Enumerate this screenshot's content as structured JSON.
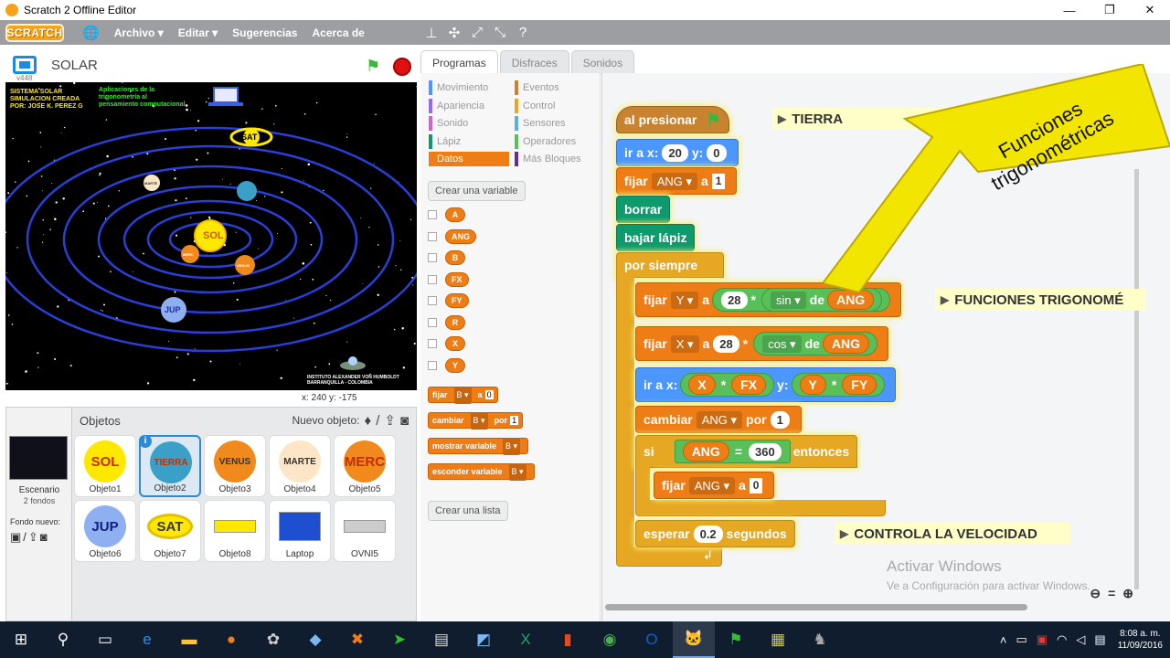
{
  "window": {
    "title": "Scratch 2 Offline Editor"
  },
  "menu": {
    "logo": "SCRATCH",
    "items": [
      "Archivo ▾",
      "Editar ▾",
      "Sugerencias",
      "Acerca de"
    ]
  },
  "stage": {
    "title": "SOLAR",
    "version": "v448",
    "coords": "x: 240  y: -175",
    "header_text": "SISTEMA SOLAR\nSIMULACION CREADA\nPOR: JOSE K. PEREZ G",
    "subtitle_text": "Aplicaciones de la\ntrigonometría al\npensamiento computacional",
    "footer_text": "INSTITUTO ALEXANDER VON HUMBOLDT\nBARRANQUILLA - COLOMBIA",
    "planet_labels": {
      "sun": "SOL",
      "sat": "SAT",
      "jup": "JUP",
      "merc": "MERC",
      "venus": "VENUS",
      "marte": "MARTE"
    }
  },
  "sprites": {
    "header": "Objetos",
    "new_label": "Nuevo objeto:",
    "stage_label": "Escenario",
    "stage_sub": "2 fondos",
    "backdrop_label": "Fondo nuevo:",
    "items": [
      {
        "name": "Objeto1",
        "label": "SOL",
        "color": "#ffe800"
      },
      {
        "name": "Objeto2",
        "label": "TIERRA",
        "color": "#3aa0c8"
      },
      {
        "name": "Objeto3",
        "label": "VENUS",
        "color": "#f08a1c"
      },
      {
        "name": "Objeto4",
        "label": "MARTE",
        "color": "#fde6c8"
      },
      {
        "name": "Objeto5",
        "label": "MERC",
        "color": "#f08a1c"
      },
      {
        "name": "Objeto6",
        "label": "JUP",
        "color": "#8fb0f0"
      },
      {
        "name": "Objeto7",
        "label": "SAT",
        "color": "#ffe800"
      },
      {
        "name": "Objeto8",
        "label": "",
        "color": "#ffe800"
      },
      {
        "name": "Laptop",
        "label": "",
        "color": "#1e4fd0"
      },
      {
        "name": "OVNI5",
        "label": "",
        "color": "#cccccc"
      }
    ]
  },
  "tabs": [
    "Programas",
    "Disfraces",
    "Sonidos"
  ],
  "categories": {
    "left": [
      {
        "label": "Movimiento",
        "color": "#4c97ff"
      },
      {
        "label": "Apariencia",
        "color": "#9966ff"
      },
      {
        "label": "Sonido",
        "color": "#cf63cf"
      },
      {
        "label": "Lápiz",
        "color": "#0e9a6c"
      },
      {
        "label": "Datos",
        "color": "#ee7d16"
      }
    ],
    "right": [
      {
        "label": "Eventos",
        "color": "#c88330"
      },
      {
        "label": "Control",
        "color": "#e6a822"
      },
      {
        "label": "Sensores",
        "color": "#5cb1d6"
      },
      {
        "label": "Operadores",
        "color": "#59c059"
      },
      {
        "label": "Más Bloques",
        "color": "#632d99"
      }
    ]
  },
  "palette": {
    "make_var": "Crear una variable",
    "make_list": "Crear una lista",
    "variables": [
      "A",
      "ANG",
      "B",
      "FX",
      "FY",
      "R",
      "X",
      "Y"
    ],
    "blocks": {
      "set": {
        "verb": "fijar",
        "var": "B ▾",
        "prep": "a",
        "val": "0"
      },
      "change": {
        "verb": "cambiar",
        "var": "B ▾",
        "prep": "por",
        "val": "1"
      },
      "show": {
        "verb": "mostrar variable",
        "var": "B ▾"
      },
      "hide": {
        "verb": "esconder variable",
        "var": "B ▾"
      }
    }
  },
  "script": {
    "hat": "al presionar",
    "goto1": {
      "verb": "ir a x:",
      "x": "20",
      "ylbl": "y:",
      "y": "0"
    },
    "set_ang": {
      "verb": "fijar",
      "var": "ANG ▾",
      "prep": "a",
      "val": "1"
    },
    "clear": "borrar",
    "pen_down": "bajar lápiz",
    "forever": "por siempre",
    "set_y": {
      "verb": "fijar",
      "var": "Y ▾",
      "prep": "a",
      "n": "28",
      "op": "*",
      "fn": "sin ▾",
      "de": "de",
      "arg": "ANG"
    },
    "set_x": {
      "verb": "fijar",
      "var": "X ▾",
      "prep": "a",
      "n": "28",
      "op": "*",
      "fn": "cos ▾",
      "de": "de",
      "arg": "ANG"
    },
    "goto2": {
      "verb": "ir a x:",
      "a": "X",
      "op": "*",
      "b": "FX",
      "ylbl": "y:",
      "c": "Y",
      "d": "FY"
    },
    "change_ang": {
      "verb": "cambiar",
      "var": "ANG ▾",
      "prep": "por",
      "val": "1"
    },
    "if": {
      "verb": "si",
      "a": "ANG",
      "op": "=",
      "b": "360",
      "then": "entonces"
    },
    "set_ang0": {
      "verb": "fijar",
      "var": "ANG ▾",
      "prep": "a",
      "val": "0"
    },
    "wait": {
      "verb": "esperar",
      "val": "0.2",
      "unit": "segundos"
    },
    "comments": {
      "tierra": "TIERRA",
      "funciones": "FUNCIONES TRIGONOMÉ",
      "velocidad": "CONTROLA LA VELOCIDAD"
    },
    "callout": "Funciones\ntrigonométricas"
  },
  "watermark": {
    "title": "Activar Windows",
    "sub": "Ve a Configuración para activar Windows."
  },
  "taskbar": {
    "time": "8:08 a. m.",
    "date": "11/09/2016"
  }
}
